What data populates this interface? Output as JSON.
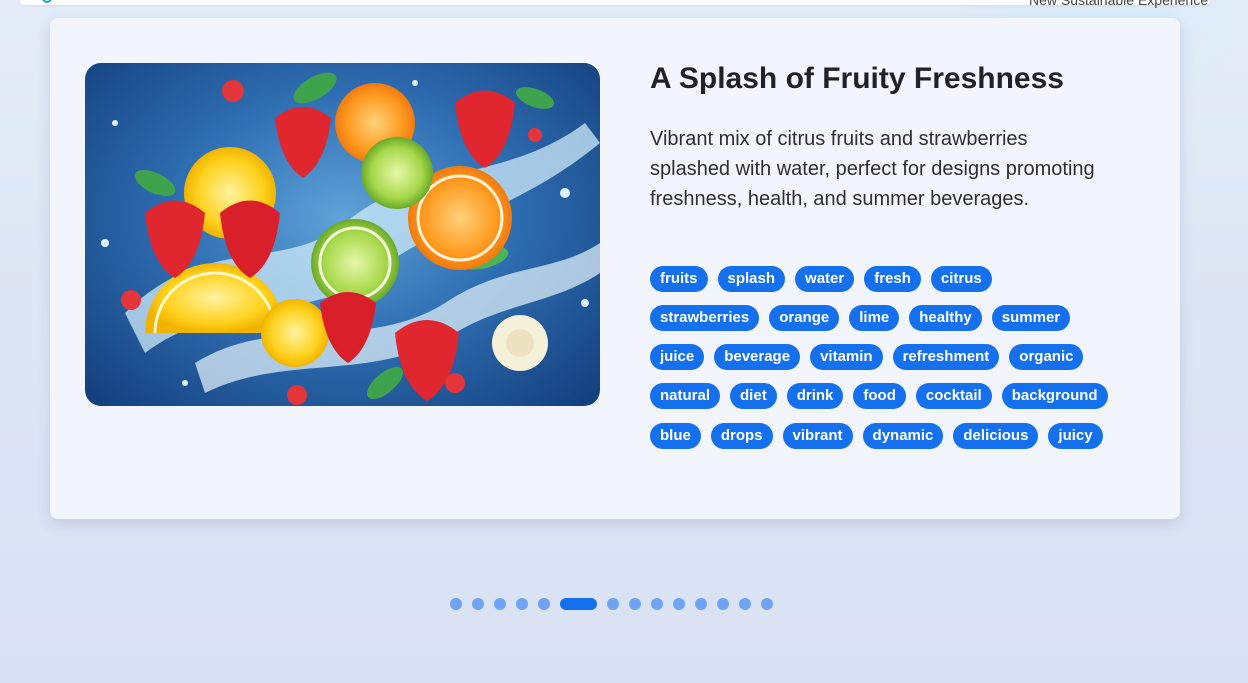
{
  "header": {
    "tagline": "New Sustainable Experience"
  },
  "card": {
    "title": "A Splash of Fruity Freshness",
    "description": "Vibrant mix of citrus fruits and strawberries splashed with water, perfect for designs promoting freshness, health, and summer beverages.",
    "tag_rows": [
      [
        "fruits",
        "splash",
        "water",
        "fresh",
        "citrus"
      ],
      [
        "strawberries",
        "orange",
        "lime",
        "healthy",
        "summer"
      ],
      [
        "juice",
        "beverage",
        "vitamin",
        "refreshment",
        "organic"
      ],
      [
        "natural",
        "diet",
        "drink",
        "food",
        "cocktail",
        "background"
      ],
      [
        "blue",
        "drops",
        "vibrant",
        "dynamic",
        "delicious",
        "juicy"
      ]
    ]
  },
  "carousel": {
    "total_slides": 14,
    "active_index": 5
  },
  "colors": {
    "accent": "#1570ee",
    "dot_inactive": "#6fa4f2"
  },
  "icons": {
    "logo": "logo-ring-icon"
  }
}
